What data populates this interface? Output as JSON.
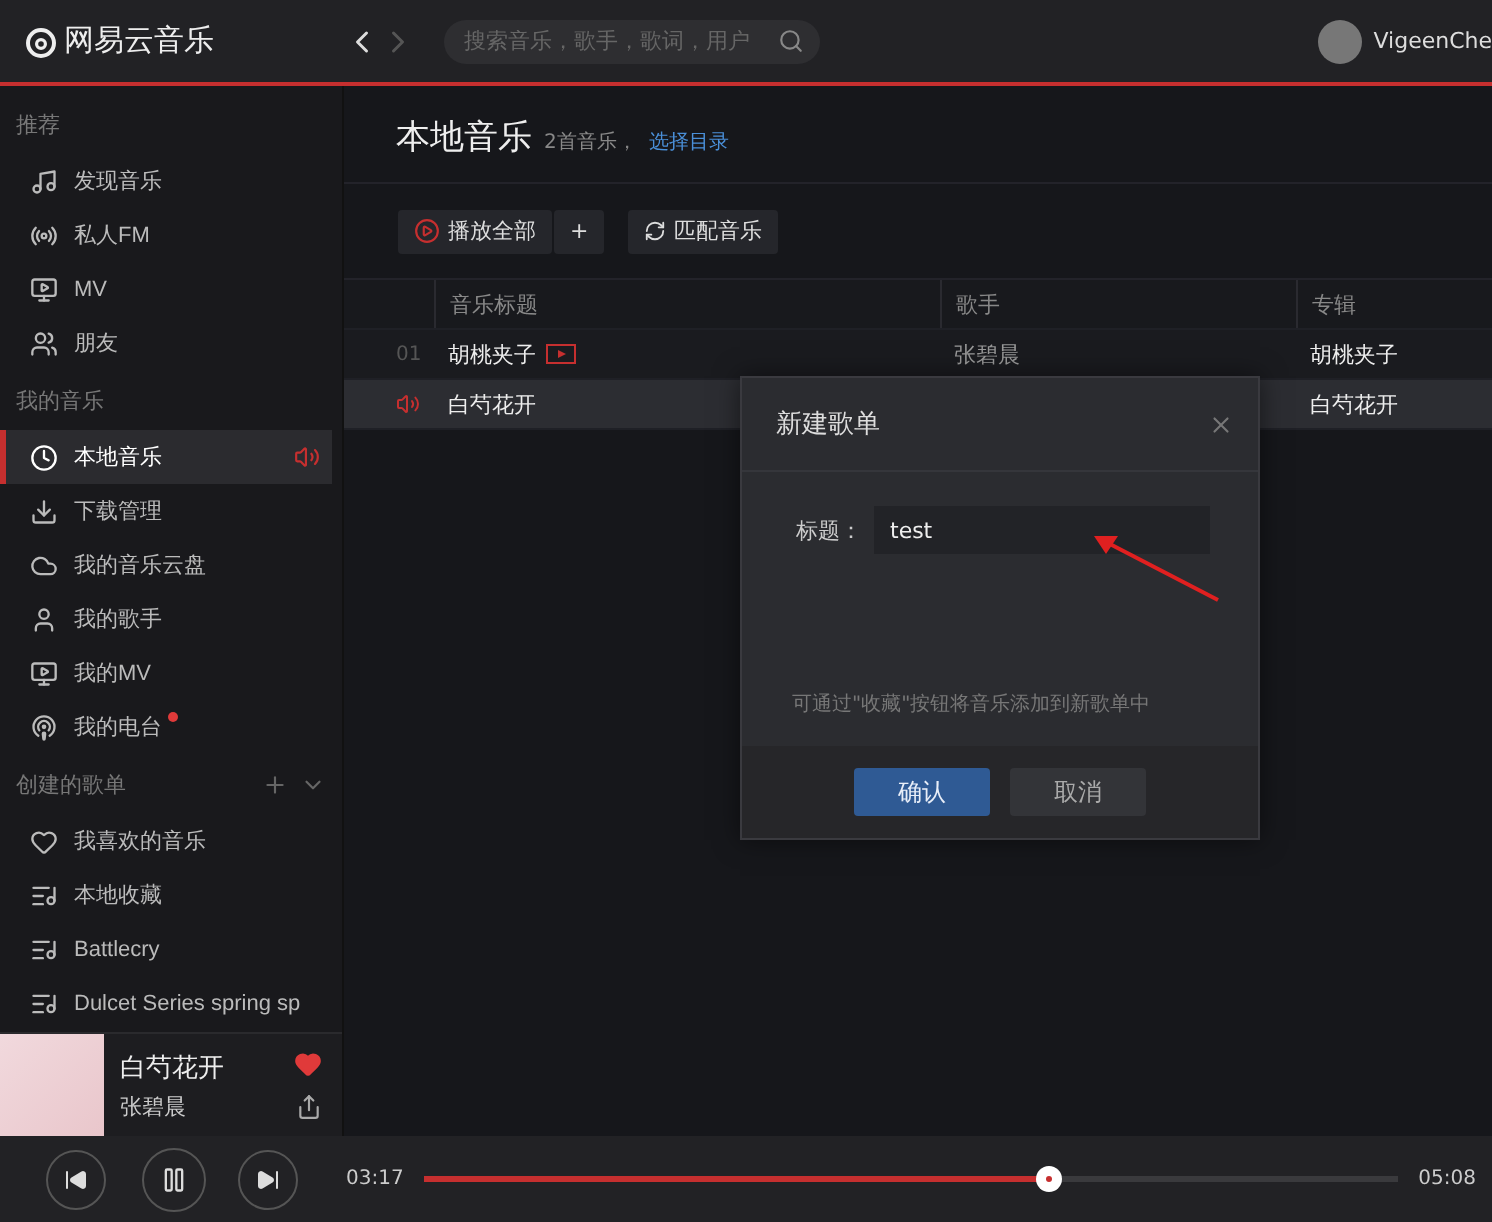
{
  "app": {
    "name": "网易云音乐"
  },
  "nav": {
    "back_disabled": false,
    "forward_disabled": true
  },
  "search": {
    "placeholder": "搜索音乐，歌手，歌词，用户"
  },
  "user": {
    "name": "VigeenChe"
  },
  "sidebar": {
    "sections": [
      {
        "title": "推荐",
        "actions": false,
        "items": [
          {
            "label": "发现音乐",
            "kind": "note",
            "selected": false,
            "dot": false
          },
          {
            "label": "私人FM",
            "kind": "radio",
            "selected": false,
            "dot": false
          },
          {
            "label": "MV",
            "kind": "video",
            "selected": false,
            "dot": false
          },
          {
            "label": "朋友",
            "kind": "friends",
            "selected": false,
            "dot": false
          }
        ]
      },
      {
        "title": "我的音乐",
        "actions": false,
        "items": [
          {
            "label": "本地音乐",
            "kind": "clock",
            "selected": true,
            "dot": false
          },
          {
            "label": "下载管理",
            "kind": "download",
            "selected": false,
            "dot": false
          },
          {
            "label": "我的音乐云盘",
            "kind": "cloud",
            "selected": false,
            "dot": false
          },
          {
            "label": "我的歌手",
            "kind": "singer",
            "selected": false,
            "dot": false
          },
          {
            "label": "我的MV",
            "kind": "video",
            "selected": false,
            "dot": false
          },
          {
            "label": "我的电台",
            "kind": "podcast",
            "selected": false,
            "dot": true
          }
        ]
      },
      {
        "title": "创建的歌单",
        "actions": true,
        "items": [
          {
            "label": "我喜欢的音乐",
            "kind": "heart",
            "selected": false,
            "dot": false
          },
          {
            "label": "本地收藏",
            "kind": "playlist",
            "selected": false,
            "dot": false
          },
          {
            "label": "Battlecry",
            "kind": "playlist",
            "selected": false,
            "dot": false
          },
          {
            "label": "Dulcet Series spring sp",
            "kind": "playlist",
            "selected": false,
            "dot": false
          }
        ]
      }
    ]
  },
  "now_playing": {
    "title": "白芍花开",
    "artist": "张碧晨",
    "liked": true
  },
  "page": {
    "title": "本地音乐",
    "count": "2首音乐，",
    "link": "选择目录"
  },
  "toolbar": {
    "play_all": "播放全部",
    "add": "+",
    "match": "匹配音乐"
  },
  "table": {
    "columns": [
      "音乐标题",
      "歌手",
      "专辑"
    ],
    "rows": [
      {
        "number": "01",
        "title": "胡桃夹子",
        "mv": true,
        "artist": "张碧晨",
        "album": "胡桃夹子",
        "selected": false,
        "playing": false
      },
      {
        "title": "白芍花开",
        "mv": false,
        "album": "白芍花开",
        "selected": true,
        "playing": true
      }
    ]
  },
  "dialog": {
    "title": "新建歌单",
    "field_label": "标题：",
    "value": "test",
    "hint": "可通过\"收藏\"按钮将音乐添加到新歌单中",
    "buttons": [
      {
        "label": "确认",
        "kind": "primary"
      },
      {
        "label": "取消",
        "kind": "secondary"
      }
    ]
  },
  "player": {
    "elapsed": "03:17",
    "total": "05:08",
    "level": 0.64,
    "paused": false
  }
}
